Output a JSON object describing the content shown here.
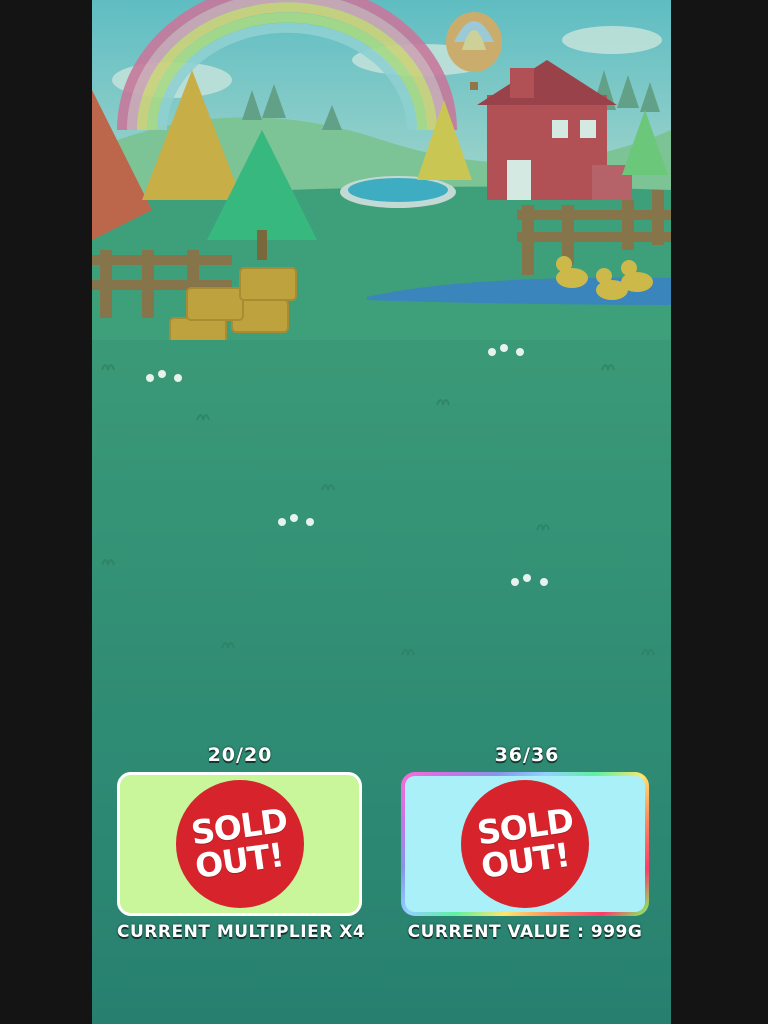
{
  "shop": {
    "left_item": {
      "stock": "20/20",
      "badge_line1": "SOLD",
      "badge_line2": "OUT!",
      "caption": "CURRENT MULTIPLIER X4"
    },
    "right_item": {
      "stock": "36/36",
      "badge_line1": "SOLD",
      "badge_line2": "OUT!",
      "caption": "CURRENT VALUE : 999G"
    }
  },
  "colors": {
    "left_card": "#c9f69a",
    "right_card": "#a9f0f8",
    "badge": "#d6232c",
    "grass": "#3a9977"
  }
}
